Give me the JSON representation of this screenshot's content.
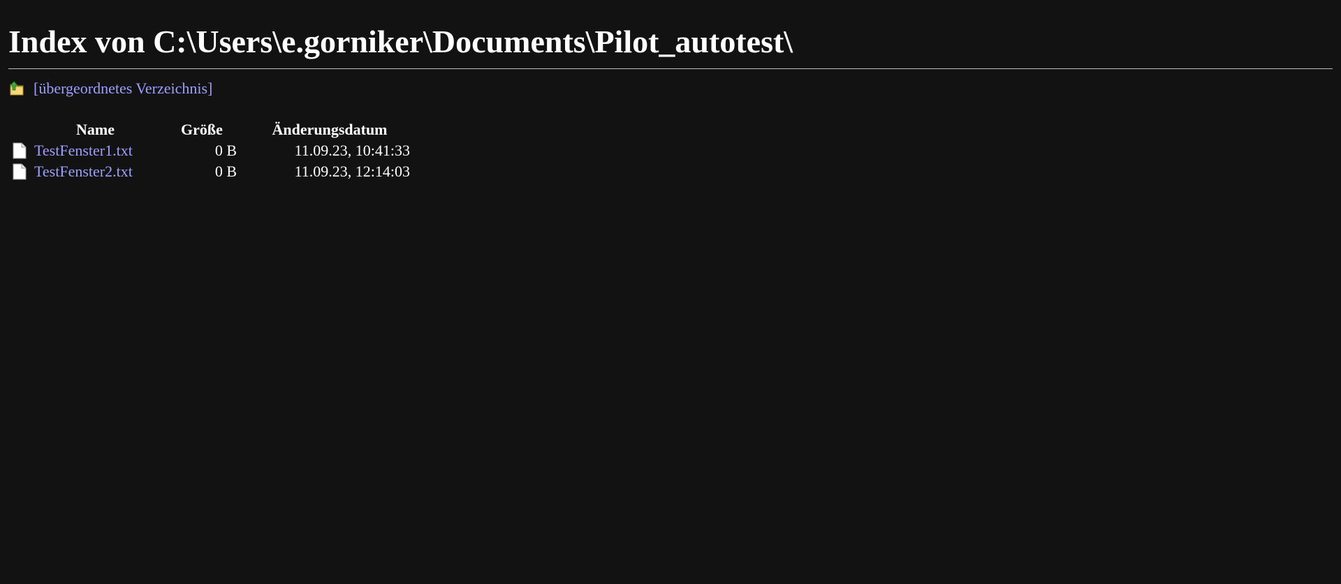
{
  "page_title": "Index von C:\\Users\\e.gorniker\\Documents\\Pilot_autotest\\",
  "parent_link": {
    "label": "[übergeordnetes Verzeichnis]",
    "icon": "folder-up-icon"
  },
  "table": {
    "headers": {
      "name": "Name",
      "size": "Größe",
      "date": "Änderungsdatum"
    },
    "rows": [
      {
        "icon": "file-icon",
        "name": "TestFenster1.txt",
        "size": "0 B",
        "date": "11.09.23, 10:41:33"
      },
      {
        "icon": "file-icon",
        "name": "TestFenster2.txt",
        "size": "0 B",
        "date": "11.09.23, 12:14:03"
      }
    ]
  },
  "colors": {
    "background": "#121212",
    "text": "#ffffff",
    "link": "#9e9eff",
    "rule": "#bdbdbd"
  }
}
